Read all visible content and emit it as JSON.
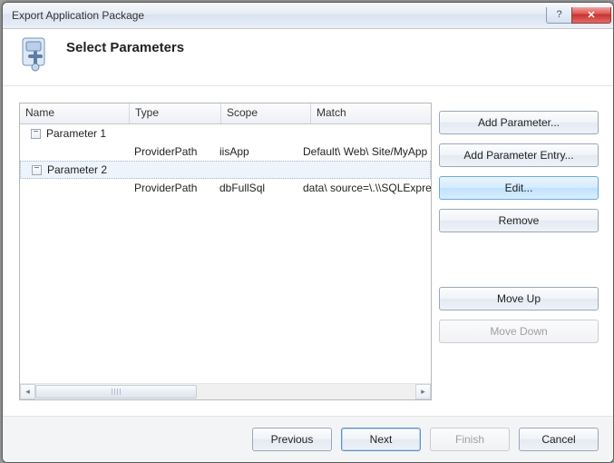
{
  "window": {
    "title": "Export Application Package"
  },
  "header": {
    "heading": "Select Parameters"
  },
  "table": {
    "columns": {
      "name": "Name",
      "type": "Type",
      "scope": "Scope",
      "match": "Match"
    },
    "groups": [
      {
        "label": "Parameter 1",
        "expanded": true,
        "selected": false,
        "children": [
          {
            "name": "",
            "type": "ProviderPath",
            "scope": "iisApp",
            "match": "Default\\ Web\\ Site/MyApp"
          }
        ]
      },
      {
        "label": "Parameter 2",
        "expanded": true,
        "selected": true,
        "children": [
          {
            "name": "",
            "type": "ProviderPath",
            "scope": "dbFullSql",
            "match": "data\\ source=\\.\\\\SQLExpre"
          }
        ]
      }
    ]
  },
  "sidebar": {
    "add_parameter": "Add Parameter...",
    "add_parameter_entry": "Add Parameter Entry...",
    "edit": "Edit...",
    "remove": "Remove",
    "move_up": "Move Up",
    "move_down": "Move Down"
  },
  "footer": {
    "previous": "Previous",
    "next": "Next",
    "finish": "Finish",
    "cancel": "Cancel"
  },
  "glyphs": {
    "minus": "−",
    "help": "?",
    "close": "✕",
    "left": "◂",
    "right": "▸"
  }
}
